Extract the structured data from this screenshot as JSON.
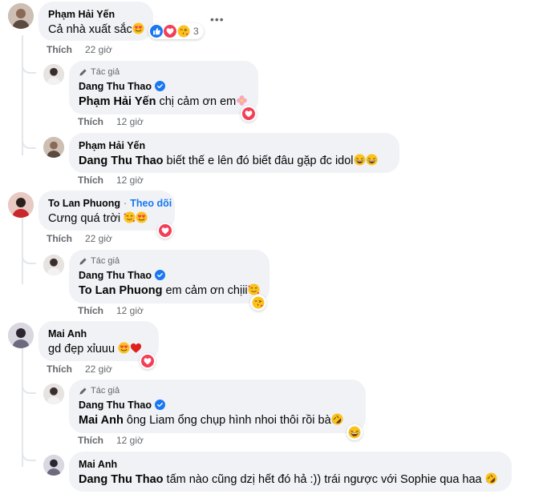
{
  "ui": {
    "like_label": "Thích",
    "author_badge": "Tác giả",
    "more_icon": "•••",
    "follow_label": "Theo dõi"
  },
  "comments": [
    {
      "name": "Phạm Hải Yến",
      "mention": "",
      "text": "Cả nhà xuất sắc",
      "time": "22 giờ",
      "reaction_count": "3"
    },
    {
      "name": "Dang Thu Thao",
      "mention": "Phạm Hải Yến",
      "text": "chị cảm ơn em",
      "time": "12 giờ"
    },
    {
      "name": "Phạm Hải Yến",
      "mention": "Dang Thu Thao",
      "text": "biết thế e lên đó biết đâu gặp đc idol",
      "time": "12 giờ"
    },
    {
      "name": "To Lan Phuong",
      "mention": "",
      "text": "Cưng quá trời",
      "time": "22 giờ"
    },
    {
      "name": "Dang Thu Thao",
      "mention": "To Lan Phuong",
      "text": "em cảm ơn chịii",
      "time": "12 giờ"
    },
    {
      "name": "Mai Anh",
      "mention": "",
      "text": "gd đẹp xỉuuu",
      "time": "22 giờ"
    },
    {
      "name": "Dang Thu Thao",
      "mention": "Mai Anh",
      "text": "ông Liam ổng chụp hình nhoi thôi rồi bà",
      "time": "12 giờ"
    },
    {
      "name": "Mai Anh",
      "mention": "Dang Thu Thao",
      "text": "tấm nào cũng dzị hết đó hả :)) trái ngược với Sophie qua haa",
      "time": ""
    }
  ],
  "colors": {
    "bubble": "#f0f2f5",
    "link_blue": "#1877f2",
    "muted": "#65676b",
    "love_red": "#f33e58"
  }
}
